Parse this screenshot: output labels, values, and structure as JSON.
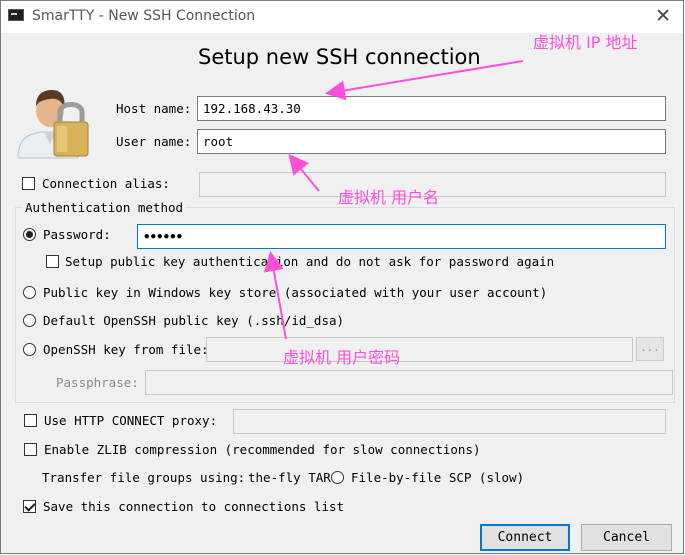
{
  "window": {
    "title": "SmarTTY - New SSH Connection"
  },
  "heading": "Setup new SSH connection",
  "host": {
    "label": "Host name:",
    "value": "192.168.43.30"
  },
  "user": {
    "label": "User name:",
    "value": "root"
  },
  "alias": {
    "label": "Connection alias:",
    "checked": false,
    "value": ""
  },
  "auth": {
    "group_label": "Authentication method",
    "password_label": "Password:",
    "password_value": "••••••",
    "setup_pubkey_label": "Setup public key authentication and do not ask for password again",
    "windows_key_label": "Public key in Windows key store (associated with your user account)",
    "default_openssh_label": "Default OpenSSH public key (.ssh/id_dsa)",
    "openssh_file_label": "OpenSSH key from file:",
    "browse_label": "...",
    "passphrase_label": "Passphrase:"
  },
  "http_proxy": {
    "label": "Use HTTP CONNECT proxy:",
    "checked": false
  },
  "zlib": {
    "label": "Enable ZLIB compression (recommended for slow connections)",
    "checked": false
  },
  "transfer": {
    "label": "Transfer file groups using:",
    "option_onthefly": "the-fly TAR",
    "option_filebyfile": "File-by-file SCP (slow)"
  },
  "save": {
    "label": "Save this connection to connections list",
    "checked": true
  },
  "buttons": {
    "connect": "Connect",
    "cancel": "Cancel"
  },
  "annotations": {
    "ip": "虚拟机 IP 地址",
    "username": "虚拟机 用户名",
    "password": "虚拟机 用户密码",
    "color": "#ff4fd8"
  }
}
